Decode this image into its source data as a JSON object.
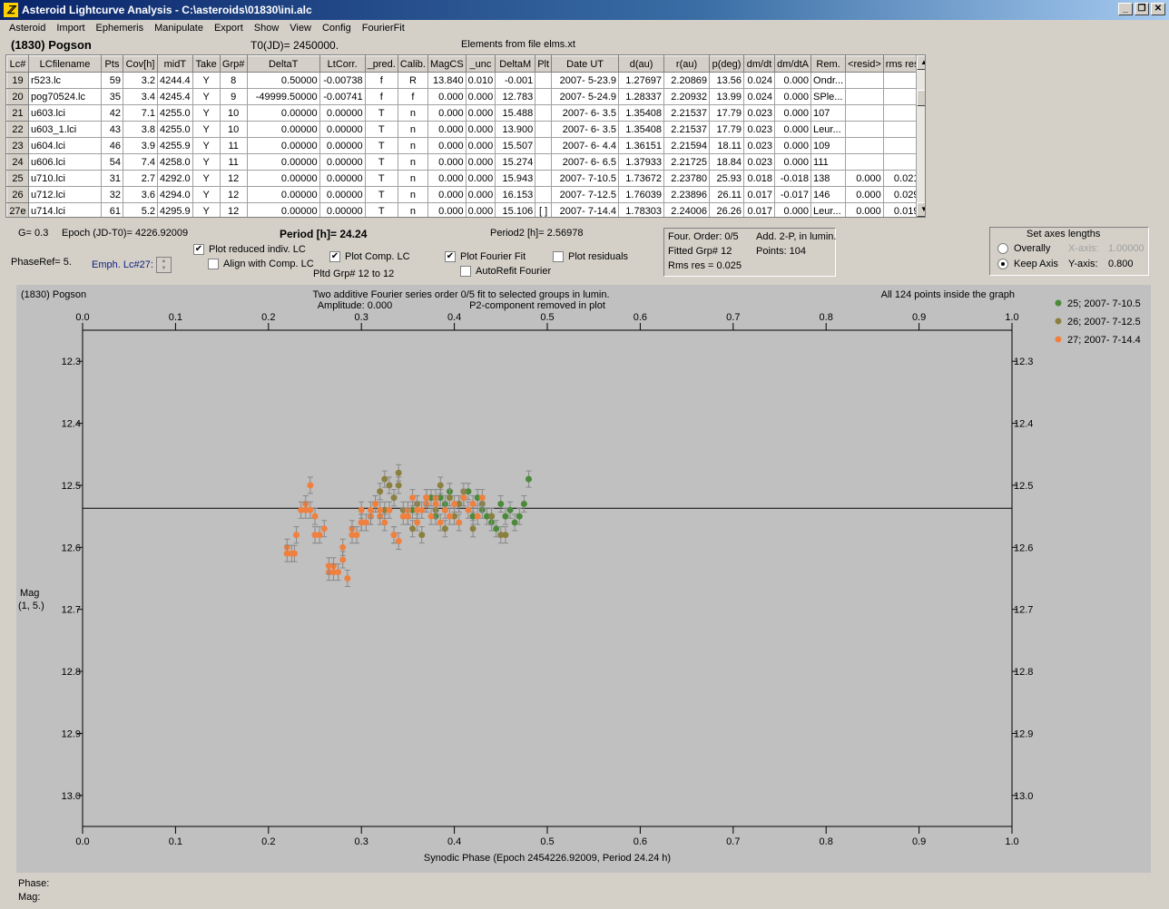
{
  "window": {
    "title": "Asteroid Lightcurve Analysis - C:\\asteroids\\01830\\ini.alc",
    "icon_letter": "ℤ",
    "min": "_",
    "restore": "❐",
    "close": "✕"
  },
  "menu": [
    "Asteroid",
    "Import",
    "Ephemeris",
    "Manipulate",
    "Export",
    "Show",
    "View",
    "Config",
    "FourierFit"
  ],
  "header": {
    "asteroid": "(1830) Pogson",
    "t0": "T0(JD)= 2450000.",
    "elements": "Elements from file elms.xt"
  },
  "table": {
    "columns": [
      "Lc#",
      "LCfilename",
      "Pts",
      "Cov[h]",
      "midT",
      "Take",
      "Grp#",
      "DeltaT",
      "LtCorr.",
      "_pred.",
      "Calib.",
      "MagCS",
      "_unc",
      "DeltaM",
      "Plt",
      "Date UT",
      "d(au)",
      "r(au)",
      "p(deg)",
      "dm/dt",
      "dm/dtA",
      "Rem.",
      "<resid>",
      "rms res"
    ],
    "rows": [
      [
        "19",
        "r523.lc",
        "59",
        "3.2",
        "4244.4",
        "Y",
        "8",
        "0.50000",
        "-0.00738",
        "f",
        "R",
        "13.840",
        "0.010",
        "-0.001",
        "",
        "2007- 5-23.9",
        "1.27697",
        "2.20869",
        "13.56",
        "0.024",
        "0.000",
        "Ondr...",
        "",
        ""
      ],
      [
        "20",
        "pog70524.lc",
        "35",
        "3.4",
        "4245.4",
        "Y",
        "9",
        "-49999.50000",
        "-0.00741",
        "f",
        "f",
        "0.000",
        "0.000",
        "12.783",
        "",
        "2007- 5-24.9",
        "1.28337",
        "2.20932",
        "13.99",
        "0.024",
        "0.000",
        "SPle...",
        "",
        ""
      ],
      [
        "21",
        "u603.lci",
        "42",
        "7.1",
        "4255.0",
        "Y",
        "10",
        "0.00000",
        "0.00000",
        "T",
        "n",
        "0.000",
        "0.000",
        "15.488",
        "",
        "2007- 6- 3.5",
        "1.35408",
        "2.21537",
        "17.79",
        "0.023",
        "0.000",
        "107",
        "",
        ""
      ],
      [
        "22",
        "u603_1.lci",
        "43",
        "3.8",
        "4255.0",
        "Y",
        "10",
        "0.00000",
        "0.00000",
        "T",
        "n",
        "0.000",
        "0.000",
        "13.900",
        "",
        "2007- 6- 3.5",
        "1.35408",
        "2.21537",
        "17.79",
        "0.023",
        "0.000",
        "Leur...",
        "",
        ""
      ],
      [
        "23",
        "u604.lci",
        "46",
        "3.9",
        "4255.9",
        "Y",
        "11",
        "0.00000",
        "0.00000",
        "T",
        "n",
        "0.000",
        "0.000",
        "15.507",
        "",
        "2007- 6- 4.4",
        "1.36151",
        "2.21594",
        "18.11",
        "0.023",
        "0.000",
        "109",
        "",
        ""
      ],
      [
        "24",
        "u606.lci",
        "54",
        "7.4",
        "4258.0",
        "Y",
        "11",
        "0.00000",
        "0.00000",
        "T",
        "n",
        "0.000",
        "0.000",
        "15.274",
        "",
        "2007- 6- 6.5",
        "1.37933",
        "2.21725",
        "18.84",
        "0.023",
        "0.000",
        "111",
        "",
        ""
      ],
      [
        "25",
        "u710.lci",
        "31",
        "2.7",
        "4292.0",
        "Y",
        "12",
        "0.00000",
        "0.00000",
        "T",
        "n",
        "0.000",
        "0.000",
        "15.943",
        "",
        "2007- 7-10.5",
        "1.73672",
        "2.23780",
        "25.93",
        "0.018",
        "-0.018",
        "138",
        "0.000",
        "0.021"
      ],
      [
        "26",
        "u712.lci",
        "32",
        "3.6",
        "4294.0",
        "Y",
        "12",
        "0.00000",
        "0.00000",
        "T",
        "n",
        "0.000",
        "0.000",
        "16.153",
        "",
        "2007- 7-12.5",
        "1.76039",
        "2.23896",
        "26.11",
        "0.017",
        "-0.017",
        "146",
        "0.000",
        "0.029"
      ],
      [
        "27e",
        "u714.lci",
        "61",
        "5.2",
        "4295.9",
        "Y",
        "12",
        "0.00000",
        "0.00000",
        "T",
        "n",
        "0.000",
        "0.000",
        "15.106",
        "[ ]",
        "2007- 7-14.4",
        "1.78303",
        "2.24006",
        "26.26",
        "0.017",
        "0.000",
        "Leur...",
        "0.000",
        "0.019"
      ]
    ]
  },
  "controls": {
    "g": "G= 0.3",
    "epoch": "Epoch (JD-T0)= 4226.92009",
    "period": "Period [h]= 24.24",
    "period2": "Period2 [h]= 2.56978",
    "phaseref": "PhaseRef= 5.",
    "emph": "Emph. Lc#27:",
    "plot_reduced": "Plot reduced indiv. LC",
    "align_comp": "Align with Comp. LC",
    "plot_comp": "Plot Comp. LC",
    "pltd_grp": "Pltd Grp#  12 to   12",
    "plot_fourier": "Plot Fourier Fit",
    "autorefit": "AutoRefit Fourier",
    "plot_residuals": "Plot residuals",
    "four_order": "Four. Order:  0/5",
    "add_2p": "Add. 2-P, in lumin.",
    "fitted_grp": "Fitted Grp# 12",
    "points": "Points: 104",
    "rms_res": "Rms res      = 0.025",
    "axes_title": "Set axes lengths",
    "overally": "Overally",
    "keep_axis": "Keep Axis",
    "xaxis_label": "X-axis:",
    "xaxis_val": "1.00000",
    "yaxis_label": "Y-axis:",
    "yaxis_val": "0.800",
    "check_mark": "✔",
    "arrow_up": "▲",
    "arrow_down": "▼"
  },
  "status": {
    "phase": "Phase:",
    "mag": "Mag:"
  },
  "colors": {
    "s25": "#4a8a3a",
    "s26": "#8a8040",
    "s27": "#f08040"
  },
  "chart_data": {
    "type": "scatter",
    "title_left": "(1830) Pogson",
    "title_center": "Two additive Fourier series order 0/5 fit to selected groups in lumin.",
    "subtitle_amp": "Amplitude: 0.000",
    "subtitle_p2": "P2-component removed in plot",
    "title_right": "All 124 points inside the graph",
    "xlabel": "Synodic Phase (Epoch 2454226.92009, Period 24.24 h)",
    "ylabel": "Mag",
    "ylabel2": "(1, 5.)",
    "xlim": [
      0.0,
      1.0
    ],
    "ylim": [
      12.25,
      13.05
    ],
    "y_inverted": true,
    "xticks": [
      "0.0",
      "0.1",
      "0.2",
      "0.3",
      "0.4",
      "0.5",
      "0.6",
      "0.7",
      "0.8",
      "0.9",
      "1.0"
    ],
    "yticks": [
      "12.3",
      "12.4",
      "12.5",
      "12.6",
      "12.7",
      "12.8",
      "12.9",
      "13.0"
    ],
    "fit_line_y": 12.537,
    "series": [
      {
        "name": "25; 2007- 7-10.5",
        "x": [
          0.355,
          0.37,
          0.38,
          0.385,
          0.395,
          0.405,
          0.41,
          0.42,
          0.425,
          0.43,
          0.435,
          0.44,
          0.445,
          0.45,
          0.455,
          0.46,
          0.465,
          0.47,
          0.475,
          0.48,
          0.39,
          0.375,
          0.415,
          0.44
        ],
        "y": [
          12.54,
          12.53,
          12.55,
          12.52,
          12.51,
          12.53,
          12.52,
          12.55,
          12.52,
          12.54,
          12.55,
          12.56,
          12.57,
          12.53,
          12.55,
          12.54,
          12.56,
          12.55,
          12.53,
          12.49,
          12.53,
          12.52,
          12.51,
          12.55
        ]
      },
      {
        "name": "26; 2007- 7-12.5",
        "x": [
          0.3,
          0.31,
          0.315,
          0.32,
          0.325,
          0.33,
          0.335,
          0.34,
          0.345,
          0.35,
          0.355,
          0.36,
          0.365,
          0.37,
          0.38,
          0.385,
          0.39,
          0.395,
          0.4,
          0.405,
          0.41,
          0.42,
          0.43,
          0.44,
          0.45,
          0.455,
          0.325,
          0.34
        ],
        "y": [
          12.56,
          12.55,
          12.53,
          12.51,
          12.49,
          12.5,
          12.52,
          12.48,
          12.54,
          12.55,
          12.57,
          12.53,
          12.58,
          12.52,
          12.54,
          12.5,
          12.57,
          12.52,
          12.55,
          12.53,
          12.51,
          12.57,
          12.53,
          12.55,
          12.58,
          12.58,
          12.54,
          12.5
        ]
      },
      {
        "name": "27; 2007- 7-14.4",
        "x": [
          0.22,
          0.225,
          0.23,
          0.235,
          0.24,
          0.245,
          0.25,
          0.255,
          0.26,
          0.265,
          0.27,
          0.275,
          0.28,
          0.285,
          0.29,
          0.295,
          0.3,
          0.305,
          0.31,
          0.315,
          0.32,
          0.325,
          0.33,
          0.335,
          0.34,
          0.345,
          0.35,
          0.355,
          0.36,
          0.365,
          0.37,
          0.375,
          0.38,
          0.385,
          0.39,
          0.395,
          0.4,
          0.405,
          0.41,
          0.415,
          0.42,
          0.425,
          0.43,
          0.22,
          0.228,
          0.245,
          0.25,
          0.265,
          0.27,
          0.28,
          0.24,
          0.29,
          0.3,
          0.31,
          0.32,
          0.335,
          0.35,
          0.36,
          0.37,
          0.38
        ],
        "y": [
          12.6,
          12.61,
          12.58,
          12.54,
          12.53,
          12.5,
          12.55,
          12.58,
          12.57,
          12.64,
          12.63,
          12.64,
          12.6,
          12.65,
          12.57,
          12.58,
          12.54,
          12.56,
          12.55,
          12.53,
          12.55,
          12.56,
          12.54,
          12.58,
          12.59,
          12.55,
          12.54,
          12.52,
          12.56,
          12.54,
          12.53,
          12.55,
          12.52,
          12.56,
          12.54,
          12.55,
          12.53,
          12.56,
          12.52,
          12.54,
          12.53,
          12.55,
          12.52,
          12.61,
          12.61,
          12.54,
          12.58,
          12.63,
          12.64,
          12.62,
          12.54,
          12.58,
          12.56,
          12.54,
          12.54,
          12.58,
          12.55,
          12.54,
          12.52,
          12.53
        ]
      }
    ]
  }
}
